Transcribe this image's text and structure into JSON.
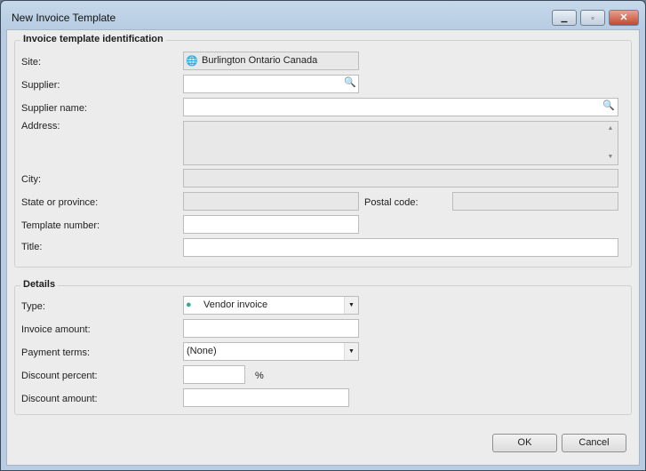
{
  "window": {
    "title": "New Invoice Template"
  },
  "identification": {
    "heading": "Invoice template identification",
    "site_label": "Site:",
    "site_value": "Burlington Ontario Canada",
    "supplier_label": "Supplier:",
    "supplier_name_label": "Supplier name:",
    "address_label": "Address:",
    "city_label": "City:",
    "state_label": "State or province:",
    "postal_label": "Postal code:",
    "template_number_label": "Template number:",
    "title_label": "Title:"
  },
  "details": {
    "heading": "Details",
    "type_label": "Type:",
    "type_value": "Vendor invoice",
    "amount_label": "Invoice amount:",
    "terms_label": "Payment terms:",
    "terms_value": "(None)",
    "discount_percent_label": "Discount percent:",
    "percent_sign": "%",
    "discount_amount_label": "Discount amount:"
  },
  "buttons": {
    "ok": "OK",
    "cancel": "Cancel"
  }
}
